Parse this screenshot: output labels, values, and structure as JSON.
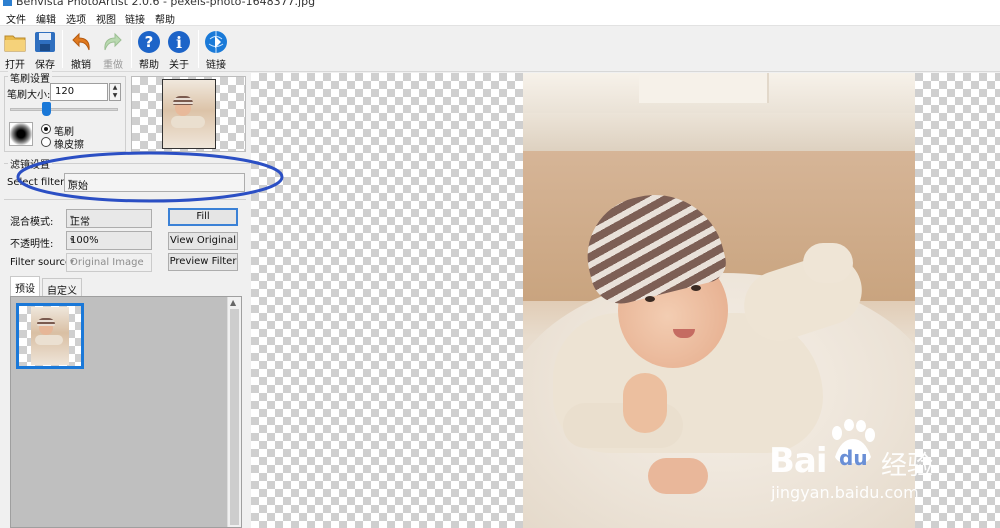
{
  "window": {
    "title": "Benvista PhotoArtist 2.0.6 - pexels-photo-1648377.jpg"
  },
  "menu": [
    "文件",
    "编辑",
    "选项",
    "视图",
    "链接",
    "帮助"
  ],
  "toolbar": {
    "open": "打开",
    "save": "保存",
    "undo": "撤销",
    "redo": "重做",
    "help": "帮助",
    "about": "关于",
    "link": "链接"
  },
  "brush": {
    "group_title": "笔刷设置",
    "size_label": "笔刷大小:",
    "size_value": "120",
    "mode_brush": "笔刷",
    "mode_eraser": "橡皮擦",
    "selected_mode": "brush"
  },
  "filter": {
    "group_title": "滤镜设置",
    "select_label": "Select filter:",
    "selected": "原始",
    "blend_label": "混合模式:",
    "blend_value": "正常",
    "opacity_label": "不透明性:",
    "opacity_value": "100%",
    "source_label": "Filter source:",
    "source_value": "Original Image",
    "fill_btn": "Fill",
    "view_original_btn": "View Original",
    "preview_filter_btn": "Preview Filter"
  },
  "tabs": [
    "预设",
    "自定义"
  ],
  "watermark": {
    "brand": "Bai",
    "paw_text": "du",
    "suffix": "经验",
    "url": "jingyan.baidu.com"
  },
  "colors": {
    "accent": "#1a78d8",
    "annotation": "#2b4fc4",
    "selection": "#1a78d8"
  }
}
